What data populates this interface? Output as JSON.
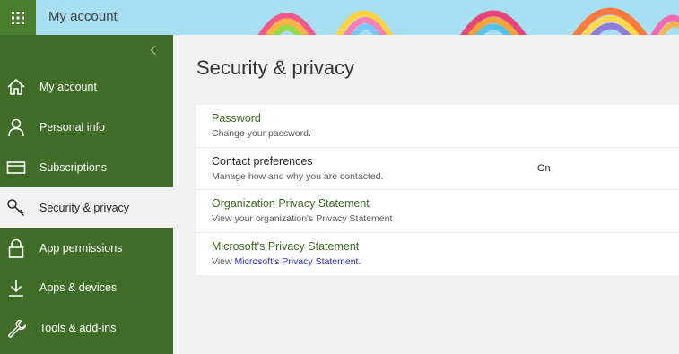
{
  "app": {
    "title": "My account",
    "icons": {
      "launcher": "app-launcher-waffle-icon",
      "collapse": "chevron-left-icon"
    },
    "colors": {
      "nav_green": "#3f6c27",
      "launcher_green": "#4b7e2e",
      "banner_blue": "#a8dff3",
      "link_green": "#3c6a26",
      "link_blue": "#2b2bd6"
    }
  },
  "sidebar": {
    "items": [
      {
        "label": "My account",
        "icon": "home-icon",
        "active": false
      },
      {
        "label": "Personal info",
        "icon": "person-icon",
        "active": false
      },
      {
        "label": "Subscriptions",
        "icon": "credit-card-icon",
        "active": false
      },
      {
        "label": "Security & privacy",
        "icon": "key-icon",
        "active": true
      },
      {
        "label": "App permissions",
        "icon": "lock-icon",
        "active": false
      },
      {
        "label": "Apps & devices",
        "icon": "download-icon",
        "active": false
      },
      {
        "label": "Tools & add-ins",
        "icon": "wrench-icon",
        "active": false
      }
    ]
  },
  "main": {
    "title": "Security & privacy",
    "settings": [
      {
        "title": "Password",
        "description": "Change your password."
      },
      {
        "title": "Contact preferences",
        "description": "Manage how and why you are contacted.",
        "value": "On"
      },
      {
        "title": "Organization Privacy Statement",
        "description": "View your organization's Privacy Statement"
      },
      {
        "title": "Microsoft's Privacy Statement",
        "description_prefix": "View ",
        "description_link": "Microsoft's Privacy Statement."
      }
    ]
  }
}
